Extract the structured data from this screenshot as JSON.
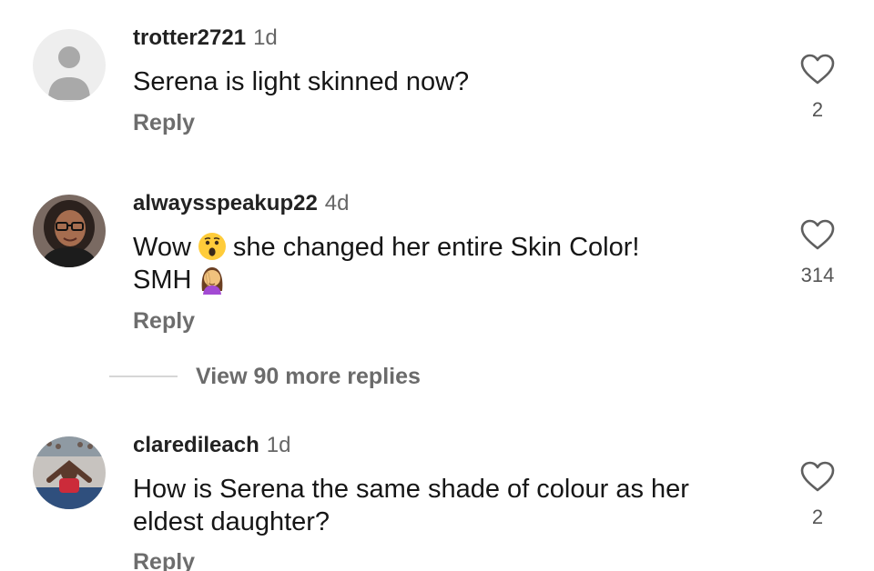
{
  "comments": [
    {
      "username": "trotter2721",
      "age": "1d",
      "text": "Serena is light skinned now?",
      "reply_label": "Reply",
      "like_count": "2",
      "avatar": "default-user-icon"
    },
    {
      "username": "alwaysspeakup22",
      "age": "4d",
      "text_before": "Wow",
      "text_after": "she changed her entire Skin Color!",
      "text_line2": "SMH",
      "emoji_1": "surprised-face-emoji",
      "emoji_2": "facepalm-woman-emoji",
      "reply_label": "Reply",
      "like_count": "314",
      "avatar": "woman-with-glasses-photo",
      "view_more_label": "View 90 more replies"
    },
    {
      "username": "claredileach",
      "age": "1d",
      "text": "How is Serena the same shade of colour as her eldest daughter?",
      "reply_label": "Reply",
      "like_count": "2",
      "avatar": "tennis-player-photo"
    }
  ],
  "icons": {
    "like": "heart-outline-icon"
  },
  "colors": {
    "username": "#222222",
    "secondary": "#6d6d6d",
    "background": "#ffffff"
  }
}
